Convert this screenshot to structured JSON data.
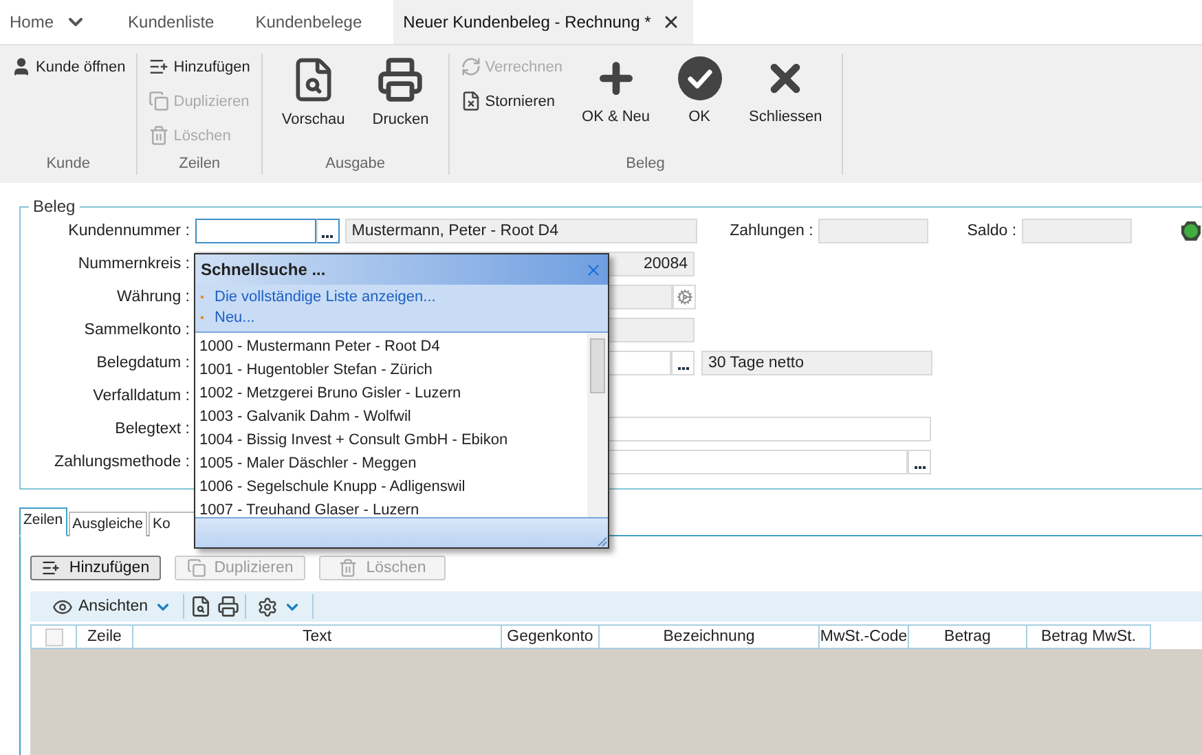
{
  "tabs": [
    {
      "label": "Home",
      "selected": false,
      "kind": "menu"
    },
    {
      "label": "Kundenliste",
      "selected": false,
      "kind": "plain"
    },
    {
      "label": "Kundenbelege",
      "selected": false,
      "kind": "plain"
    },
    {
      "label": "Neuer Kundenbeleg - Rechnung *",
      "selected": true,
      "kind": "closable"
    }
  ],
  "ribbon": {
    "groups": [
      {
        "label": "Kunde",
        "items": [
          {
            "label": "Kunde öffnen",
            "kind": "small",
            "disabled": false
          }
        ]
      },
      {
        "label": "Zeilen",
        "items": [
          {
            "label": "Hinzufügen",
            "kind": "small",
            "disabled": false
          },
          {
            "label": "Duplizieren",
            "kind": "small",
            "disabled": true
          },
          {
            "label": "Löschen",
            "kind": "small",
            "disabled": true
          }
        ]
      },
      {
        "label": "Ausgabe",
        "items": [
          {
            "label": "Vorschau",
            "kind": "large"
          },
          {
            "label": "Drucken",
            "kind": "large"
          }
        ]
      },
      {
        "label": "Beleg",
        "items": [
          {
            "label": "Verrechnen",
            "kind": "small",
            "disabled": true
          },
          {
            "label": "Stornieren",
            "kind": "small",
            "disabled": false
          },
          {
            "label": "OK & Neu",
            "kind": "large"
          },
          {
            "label": "OK",
            "kind": "large"
          },
          {
            "label": "Schliessen",
            "kind": "large"
          }
        ]
      }
    ]
  },
  "form": {
    "title": "Beleg",
    "rows": [
      {
        "kind": "customer",
        "label": "Kundennummer :",
        "focused": true,
        "name": "Mustermann, Peter - Root D4",
        "payments_label": "Zahlungen :",
        "balance_label": "Saldo :"
      },
      {
        "kind": "number",
        "label": "Nummernkreis :",
        "value": "20084"
      },
      {
        "kind": "currency",
        "label": "Währung :"
      },
      {
        "kind": "plain",
        "label": "Sammelkonto :"
      },
      {
        "kind": "date-terms",
        "label": "Belegdatum :",
        "terms": "30 Tage netto"
      },
      {
        "kind": "date",
        "label": "Verfalldatum :"
      },
      {
        "kind": "text",
        "label": "Belegtext :"
      },
      {
        "kind": "method",
        "label": "Zahlungsmethode :"
      }
    ]
  },
  "quick_search": {
    "title": "Schnellsuche ...",
    "links": [
      "Die vollständige Liste anzeigen...",
      "Neu..."
    ],
    "items": [
      "1000 - Mustermann Peter - Root D4",
      "1001 - Hugentobler Stefan - Zürich",
      "1002 - Metzgerei Bruno Gisler - Luzern",
      "1003 - Galvanik Dahm - Wolfwil",
      "1004 - Bissig Invest + Consult GmbH - Ebikon",
      "1005 - Maler Däschler - Meggen",
      "1006 - Segelschule Knupp - Adligenswil",
      "1007 - Treuhand Glaser - Luzern"
    ]
  },
  "detail_tabs": [
    {
      "label": "Zeilen",
      "selected": true
    },
    {
      "label": "Ausgleiche",
      "selected": false
    },
    {
      "label": "Ko",
      "selected": false
    }
  ],
  "line_buttons": [
    {
      "label": "Hinzufügen",
      "disabled": false
    },
    {
      "label": "Duplizieren",
      "disabled": true
    },
    {
      "label": "Löschen",
      "disabled": true
    }
  ],
  "toolbar": {
    "views_label": "Ansichten"
  },
  "table": {
    "select_all_checked": false,
    "columns": [
      "Zeile",
      "Text",
      "Gegenkonto",
      "Bezeichnung",
      "MwSt.-Code",
      "Betrag",
      "Betrag MwSt."
    ]
  }
}
